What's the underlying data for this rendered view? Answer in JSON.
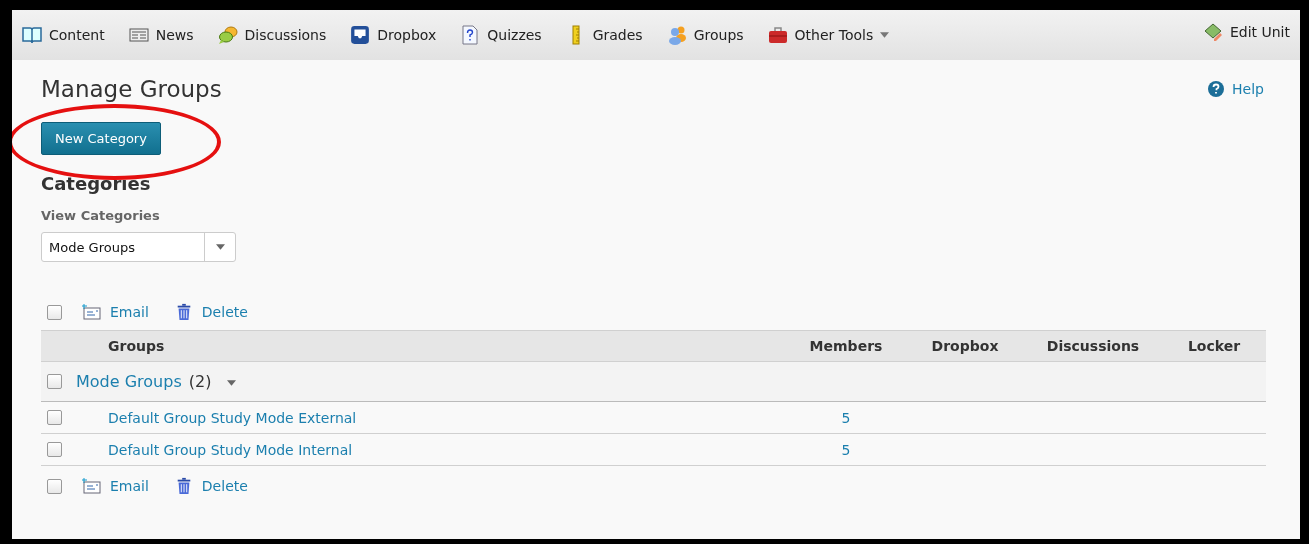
{
  "nav": {
    "items": [
      {
        "label": "Content"
      },
      {
        "label": "News"
      },
      {
        "label": "Discussions"
      },
      {
        "label": "Dropbox"
      },
      {
        "label": "Quizzes"
      },
      {
        "label": "Grades"
      },
      {
        "label": "Groups"
      },
      {
        "label": "Other Tools",
        "dropdown": true
      }
    ],
    "edit": {
      "label": "Edit Unit"
    }
  },
  "page": {
    "title": "Manage Groups",
    "help": "Help",
    "new_button": "New Category",
    "section": "Categories",
    "view_label": "View Categories",
    "view_value": "Mode Groups"
  },
  "toolbar_top": {
    "checked": false,
    "actions": [
      {
        "label": "Email"
      },
      {
        "label": "Delete"
      }
    ]
  },
  "table": {
    "columns": [
      "Groups",
      "Members",
      "Dropbox",
      "Discussions",
      "Locker"
    ],
    "category": {
      "name": "Mode Groups",
      "count": "(2)",
      "checked": false,
      "expanded": true
    },
    "rows": [
      {
        "name": "Default Group Study Mode External",
        "members": "5",
        "checked": false
      },
      {
        "name": "Default Group Study Mode Internal",
        "members": "5",
        "checked": false
      }
    ]
  },
  "toolbar_bottom": {
    "checked": false,
    "actions": [
      {
        "label": "Email"
      },
      {
        "label": "Delete"
      }
    ]
  }
}
